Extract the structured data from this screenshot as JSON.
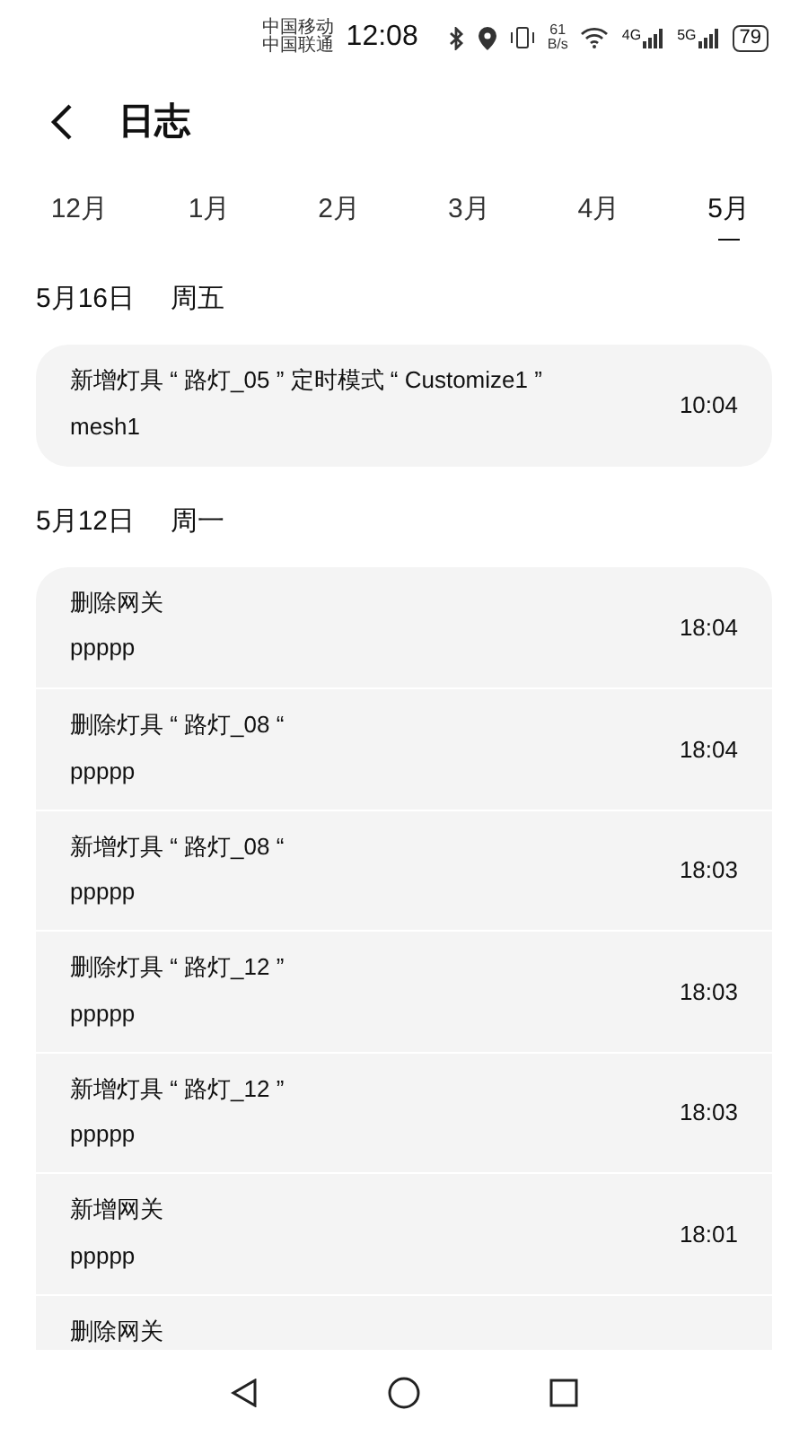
{
  "status_bar": {
    "carriers": [
      "中国移动",
      "中国联通"
    ],
    "time": "12:08",
    "speed_value": "61",
    "speed_unit": "B/s",
    "network_1": "4G",
    "network_2": "5G",
    "battery": "79"
  },
  "header": {
    "title": "日志"
  },
  "tabs": [
    {
      "label": "12月",
      "selected": false
    },
    {
      "label": "1月",
      "selected": false
    },
    {
      "label": "2月",
      "selected": false
    },
    {
      "label": "3月",
      "selected": false
    },
    {
      "label": "4月",
      "selected": false
    },
    {
      "label": "5月",
      "selected": true
    }
  ],
  "groups": [
    {
      "date": "5月16日",
      "weekday": "周五",
      "entries": [
        {
          "title": "新增灯具 “ 路灯_05 ” 定时模式 “ Customize1 ”",
          "subtitle": "mesh1",
          "time": "10:04"
        }
      ]
    },
    {
      "date": "5月12日",
      "weekday": "周一",
      "entries": [
        {
          "title": "删除网关",
          "subtitle": "ppppp",
          "time": "18:04"
        },
        {
          "title": "删除灯具 “ 路灯_08 “",
          "subtitle": "ppppp",
          "time": "18:04"
        },
        {
          "title": "新增灯具 “ 路灯_08 “",
          "subtitle": "ppppp",
          "time": "18:03"
        },
        {
          "title": "删除灯具 “ 路灯_12 ”",
          "subtitle": "ppppp",
          "time": "18:03"
        },
        {
          "title": "新增灯具 “ 路灯_12 ”",
          "subtitle": "ppppp",
          "time": "18:03"
        },
        {
          "title": "新增网关",
          "subtitle": "ppppp",
          "time": "18:01"
        },
        {
          "title": "删除网关"
        }
      ]
    }
  ]
}
